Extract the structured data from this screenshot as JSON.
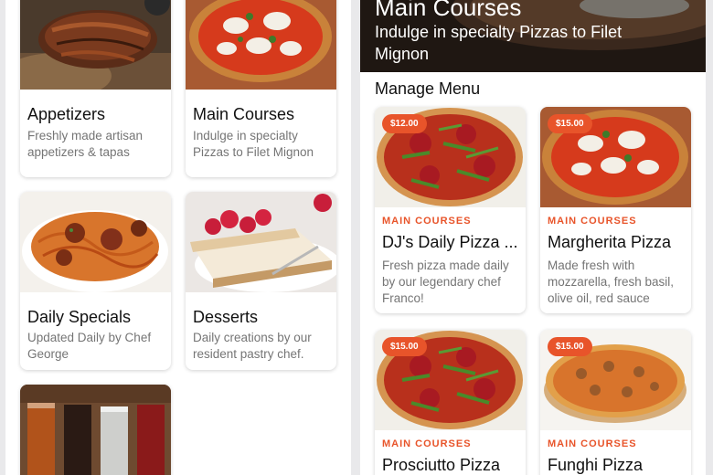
{
  "categories": [
    {
      "title": "Appetizers",
      "description": "Freshly made artisan appetizers & tapas",
      "image": "roasted-meat-photo"
    },
    {
      "title": "Main Courses",
      "description": "Indulge in specialty Pizzas to Filet Mignon",
      "image": "pizza-photo"
    },
    {
      "title": "Daily Specials",
      "description": "Updated Daily by Chef George",
      "image": "spaghetti-meatballs-photo"
    },
    {
      "title": "Desserts",
      "description": "Daily creations by our resident pastry chef.",
      "image": "cheesecake-photo"
    },
    {
      "title": "",
      "description": "",
      "image": "drinks-photo"
    }
  ],
  "detail": {
    "title": "Main Courses",
    "subtitle": "Indulge in specialty Pizzas to Filet Mignon",
    "section_title": "Manage Menu",
    "items": [
      {
        "price": "$12.00",
        "category": "MAIN COURSES",
        "name": "DJ's Daily Pizza ...",
        "description": "Fresh pizza made daily by our legendary chef Franco!"
      },
      {
        "price": "$15.00",
        "category": "MAIN COURSES",
        "name": "Margherita Pizza",
        "description": "Made fresh with mozzarella, fresh basil, olive oil, red sauce"
      },
      {
        "price": "$15.00",
        "category": "MAIN COURSES",
        "name": "Prosciutto Pizza",
        "description": ""
      },
      {
        "price": "$15.00",
        "category": "MAIN COURSES",
        "name": "Funghi Pizza",
        "description": ""
      }
    ]
  },
  "colors": {
    "accent": "#e8542a",
    "background": "#e9e9eb",
    "card": "#ffffff",
    "muted_text": "#757575"
  }
}
